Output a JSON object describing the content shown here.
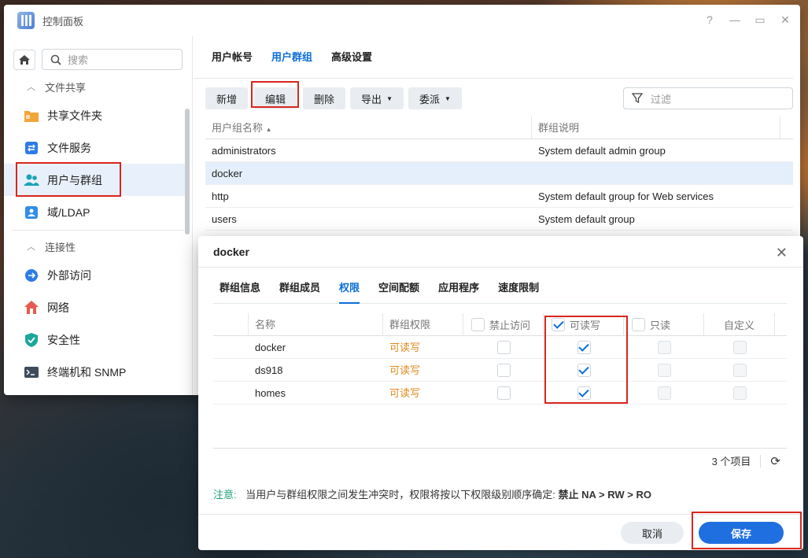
{
  "window": {
    "title": "控制面板"
  },
  "sidebar": {
    "search_placeholder": "搜索",
    "sections": [
      {
        "label": "文件共享"
      },
      {
        "label": "连接性"
      }
    ],
    "items": [
      {
        "label": "共享文件夹",
        "icon": "shared-folder-icon"
      },
      {
        "label": "文件服务",
        "icon": "file-services-icon"
      },
      {
        "label": "用户与群组",
        "icon": "users-groups-icon",
        "active": true
      },
      {
        "label": "域/LDAP",
        "icon": "domain-ldap-icon"
      },
      {
        "label": "外部访问",
        "icon": "external-access-icon"
      },
      {
        "label": "网络",
        "icon": "network-icon"
      },
      {
        "label": "安全性",
        "icon": "security-icon"
      },
      {
        "label": "终端机和 SNMP",
        "icon": "terminal-snmp-icon"
      }
    ]
  },
  "main": {
    "tabs": [
      "用户帐号",
      "用户群组",
      "高级设置"
    ],
    "active_tab": "用户群组",
    "toolbar": {
      "create": "新增",
      "edit": "编辑",
      "delete": "删除",
      "export": "导出",
      "delegate": "委派",
      "filter_placeholder": "过滤"
    },
    "grid": {
      "headers": [
        "用户组名称",
        "群组说明"
      ],
      "rows": [
        {
          "name": "administrators",
          "desc": "System default admin group"
        },
        {
          "name": "docker",
          "desc": "",
          "selected": true
        },
        {
          "name": "http",
          "desc": "System default group for Web services"
        },
        {
          "name": "users",
          "desc": "System default group"
        }
      ]
    }
  },
  "dialog": {
    "title": "docker",
    "tabs": [
      "群组信息",
      "群组成员",
      "权限",
      "空间配额",
      "应用程序",
      "速度限制"
    ],
    "active_tab": "权限",
    "perm_headers": {
      "name": "名称",
      "group_perm": "群组权限",
      "no_access": "禁止访问",
      "read_write": "可读写",
      "read_only": "只读",
      "custom": "自定义"
    },
    "rows": [
      {
        "name": "docker",
        "perm": "可读写",
        "rw": true
      },
      {
        "name": "ds918",
        "perm": "可读写",
        "rw": true
      },
      {
        "name": "homes",
        "perm": "可读写",
        "rw": true
      }
    ],
    "item_count": "3 个项目",
    "note_label": "注意:",
    "note_text": "当用户与群组权限之间发生冲突时，权限将按以下权限级别顺序确定:",
    "note_order": "禁止 NA > RW > RO",
    "cancel": "取消",
    "save": "保存"
  }
}
